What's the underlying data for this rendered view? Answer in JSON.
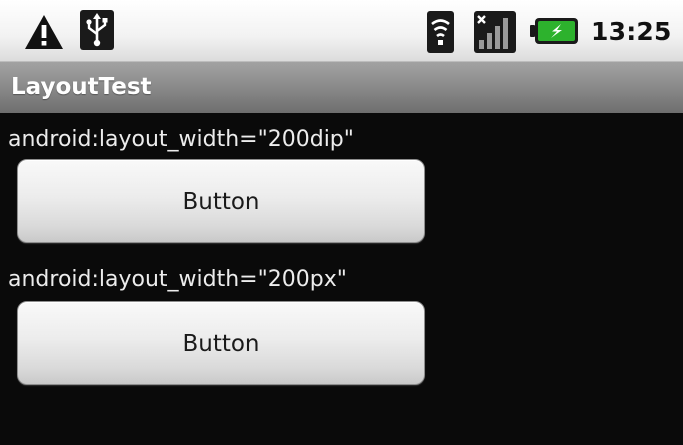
{
  "status_bar": {
    "time": "13:25",
    "icons": [
      "warning-icon",
      "usb-icon",
      "wifi-icon",
      "signal-icon",
      "battery-icon"
    ],
    "accent_color": "#2db22d"
  },
  "app": {
    "title": "LayoutTest"
  },
  "content": {
    "items": [
      {
        "label": "android:layout_width=\"200dip\"",
        "button_label": "Button"
      },
      {
        "label": "android:layout_width=\"200px\"",
        "button_label": "Button"
      }
    ]
  }
}
